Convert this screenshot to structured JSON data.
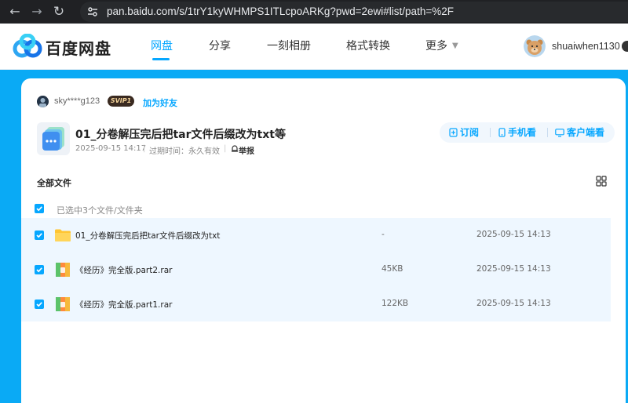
{
  "browser": {
    "url": "pan.baidu.com/s/1trY1kyWHMPS1ITLcpoARKg?pwd=2ewi#list/path=%2F"
  },
  "header": {
    "logo_text": "百度网盘",
    "nav": [
      "网盘",
      "分享",
      "一刻相册",
      "格式转换",
      "更多"
    ],
    "active_nav": "网盘",
    "username": "shuaiwhen1130",
    "accent_color": "#06a7ff"
  },
  "share": {
    "sharer_name": "sky****g123",
    "vip_badge": "SVIP1",
    "add_friend": "加为好友",
    "title": "01_分卷解压完后把tar文件后缀改为txt等",
    "created": "2025-09-15 14:17",
    "expire": "过期时间：永久有效",
    "report": "举报",
    "actions": {
      "subscribe": "订阅",
      "mobile": "手机看",
      "client": "客户端看"
    }
  },
  "files": {
    "breadcrumb": "全部文件",
    "selected_text": "已选中3个文件/文件夹",
    "rows": [
      {
        "name": "01_分卷解压完后把tar文件后缀改为txt",
        "size": "-",
        "date": "2025-09-15 14:13",
        "type": "folder",
        "checked": true
      },
      {
        "name": "《经历》完全版.part2.rar",
        "size": "45KB",
        "date": "2025-09-15 14:13",
        "type": "rar",
        "checked": true
      },
      {
        "name": "《经历》完全版.part1.rar",
        "size": "122KB",
        "date": "2025-09-15 14:13",
        "type": "rar",
        "checked": true
      }
    ]
  },
  "icons": [
    "back-icon",
    "forward-icon",
    "reload-icon",
    "site-info-icon",
    "grid-view-icon",
    "subscribe-icon",
    "phone-icon",
    "monitor-icon",
    "report-icon",
    "folder-icon",
    "rar-icon",
    "check-icon"
  ]
}
